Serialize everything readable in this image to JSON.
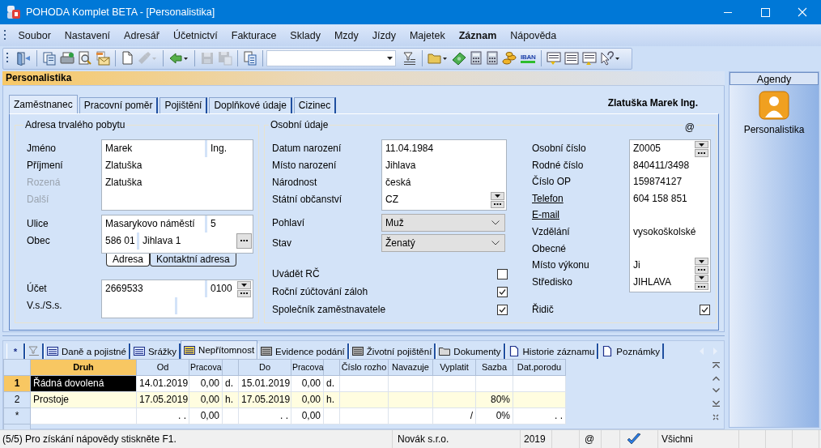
{
  "window": {
    "title": "POHODA Komplet BETA - [Personalistika]"
  },
  "menu": [
    {
      "label": "Soubor",
      "bold": false
    },
    {
      "label": "Nastavení",
      "bold": false
    },
    {
      "label": "Adresář",
      "bold": false
    },
    {
      "label": "Účetnictví",
      "bold": false
    },
    {
      "label": "Fakturace",
      "bold": false
    },
    {
      "label": "Sklady",
      "bold": false
    },
    {
      "label": "Mzdy",
      "bold": false
    },
    {
      "label": "Jízdy",
      "bold": false
    },
    {
      "label": "Majetek",
      "bold": false
    },
    {
      "label": "Záznam",
      "bold": true
    },
    {
      "label": "Nápověda",
      "bold": false
    }
  ],
  "toolbar": [
    {
      "buttons": [
        {
          "kind": "exit",
          "disabled": false
        }
      ]
    },
    {
      "buttons": [
        {
          "kind": "copy_data",
          "disabled": false
        },
        {
          "kind": "print",
          "disabled": false
        },
        {
          "kind": "preview",
          "disabled": false
        },
        {
          "kind": "mail",
          "disabled": false
        }
      ]
    },
    {
      "buttons": [
        {
          "kind": "new",
          "disabled": false
        },
        {
          "kind": "brush_menu",
          "disabled": true
        }
      ]
    },
    {
      "buttons": [
        {
          "kind": "back_menu",
          "disabled": false
        }
      ]
    },
    {
      "buttons": [
        {
          "kind": "save",
          "disabled": true
        },
        {
          "kind": "save_all",
          "disabled": true
        }
      ]
    },
    {
      "buttons": [
        {
          "kind": "copy",
          "disabled": false
        }
      ]
    },
    {
      "buttons": [
        {
          "kind": "combo",
          "disabled": false
        },
        {
          "kind": "filter",
          "disabled": false
        }
      ]
    },
    {
      "buttons": [
        {
          "kind": "folder_menu",
          "disabled": false
        },
        {
          "kind": "money",
          "disabled": false
        },
        {
          "kind": "calc",
          "disabled": false
        },
        {
          "kind": "calc2",
          "disabled": false
        },
        {
          "kind": "coins",
          "disabled": false
        },
        {
          "kind": "iban",
          "text": "IBAN",
          "disabled": false
        }
      ]
    },
    {
      "buttons": [
        {
          "kind": "list_down",
          "disabled": false
        },
        {
          "kind": "list",
          "disabled": false
        },
        {
          "kind": "list_up",
          "disabled": false
        },
        {
          "kind": "help_menu",
          "disabled": false
        }
      ]
    }
  ],
  "panel_title": "Personalistika",
  "tabs": [
    {
      "label": "Zaměstnanec",
      "selected": true
    },
    {
      "label": "Pracovní poměr",
      "selected": false
    },
    {
      "label": "Pojištění",
      "selected": false
    },
    {
      "label": "Doplňkové údaje",
      "selected": false
    },
    {
      "label": "Cizinec",
      "selected": false
    }
  ],
  "record_title": "Zlatuška Marek Ing.",
  "address": {
    "title": "Adresa trvalého pobytu",
    "name_fields": [
      {
        "label": "Jméno",
        "value": "Marek",
        "extra": "Ing.",
        "disabled": false
      },
      {
        "label": "Příjmení",
        "value": "Zlatuška",
        "disabled": false
      },
      {
        "label": "Rozená",
        "value": "Zlatuška",
        "disabled": true
      },
      {
        "label": "Další",
        "disabled": true
      }
    ],
    "address_fields": [
      {
        "label": "Ulice",
        "value": "Masarykovo náměstí",
        "extra": "5",
        "kind": "text"
      },
      {
        "label": "Obec",
        "prefix": "586 01",
        "value": "Jihlava 1",
        "kind": "lookup"
      }
    ],
    "address_tabs": [
      {
        "label": "Adresa",
        "selected": true
      },
      {
        "label": "Kontaktní adresa",
        "selected": false
      }
    ],
    "bank_fields": [
      {
        "label": "Účet",
        "value": "2669533",
        "extra": "0100",
        "kind": "combo_lookup"
      },
      {
        "label": "V.s./S.s.",
        "kind": "split"
      }
    ]
  },
  "personal": {
    "title": "Osobní údaje",
    "email_mark": "@",
    "fields": [
      {
        "label": "Datum narození",
        "value": "11.04.1984",
        "kind": "text"
      },
      {
        "label": "Místo narození",
        "value": "Jihlava",
        "kind": "text"
      },
      {
        "label": "Národnost",
        "value": "česká",
        "kind": "text"
      },
      {
        "label": "Státní občanství",
        "value": "CZ",
        "kind": "combo_lookup"
      }
    ],
    "selects": [
      {
        "label": "Pohlaví",
        "value": "Muž"
      },
      {
        "label": "Stav",
        "value": "Ženatý"
      }
    ],
    "checks": [
      {
        "label": "Uvádět RČ",
        "checked": false
      },
      {
        "label": "Roční zúčtování záloh",
        "checked": true
      },
      {
        "label": "Společník zaměstnavatele",
        "checked": true
      }
    ],
    "ids": [
      {
        "label": "Osobní číslo",
        "value": "Z0005",
        "kind": "combo_lookup",
        "link": false
      },
      {
        "label": "Rodné číslo",
        "value": "840411/3498",
        "kind": "text",
        "link": false
      },
      {
        "label": "Číslo OP",
        "value": "159874127",
        "kind": "text",
        "link": false
      },
      {
        "label": "Telefon",
        "value": "604 158 851",
        "kind": "text",
        "link": true
      },
      {
        "label": "E-mail",
        "kind": "text",
        "link": true
      },
      {
        "label": "Vzdělání",
        "value": "vysokoškolské",
        "kind": "text",
        "link": false
      },
      {
        "label": "Obecné",
        "kind": "text",
        "link": false
      },
      {
        "label": "Místo výkonu",
        "value": "Ji",
        "kind": "combo_lookup",
        "link": false
      },
      {
        "label": "Středisko",
        "value": "JIHLAVA",
        "kind": "combo_lookup",
        "link": false
      }
    ],
    "id_checks": [
      {
        "label": "Řidič",
        "checked": true
      }
    ]
  },
  "detail_tabs": [
    {
      "kind": "new",
      "label": "*",
      "selected": false
    },
    {
      "kind": "filter",
      "selected": false
    },
    {
      "kind": "table_data",
      "label": "Daně a pojistné",
      "selected": false
    },
    {
      "kind": "table_data",
      "label": "Srážky",
      "selected": false
    },
    {
      "kind": "table_data",
      "label": "Nepřítomnost",
      "selected": true
    },
    {
      "kind": "table_empty",
      "label": "Evidence podání",
      "selected": false
    },
    {
      "kind": "table_empty",
      "label": "Životní pojištění",
      "selected": false
    },
    {
      "kind": "folder",
      "label": "Dokumenty",
      "selected": false
    },
    {
      "kind": "page",
      "label": "Historie záznamu",
      "selected": false
    },
    {
      "kind": "page",
      "label": "Poznámky",
      "selected": false
    }
  ],
  "grid": {
    "columns": [
      {
        "label": "Druh",
        "sorted": true
      },
      {
        "label": "Od",
        "sorted": false
      },
      {
        "label": "Pracova",
        "sorted": false
      },
      {
        "sorted": false
      },
      {
        "label": "Do",
        "sorted": false
      },
      {
        "label": "Pracova",
        "sorted": false
      },
      {
        "sorted": false
      },
      {
        "label": "Číslo rozho",
        "sorted": false
      },
      {
        "label": "Navazuje",
        "sorted": false
      },
      {
        "label": "Vyplatit",
        "sorted": false
      },
      {
        "label": "Sazba",
        "sorted": false
      },
      {
        "label": "Dat.porodu",
        "sorted": false
      }
    ],
    "rows": [
      {
        "header": "1",
        "selected": true,
        "marked": false,
        "cells": [
          "Řádná dovolená",
          "14.01.2019",
          "0,00",
          "d.",
          "15.01.2019",
          "0,00",
          "d.",
          null,
          null,
          null,
          null,
          null
        ]
      },
      {
        "header": "2",
        "selected": false,
        "marked": true,
        "cells": [
          "Prostoje",
          "17.05.2019",
          "0,00",
          "h.",
          "17.05.2019",
          "0,00",
          "h.",
          null,
          null,
          null,
          "80%",
          null
        ]
      },
      {
        "header": "*",
        "selected": false,
        "marked": false,
        "cells": [
          null,
          ". .",
          "0,00",
          null,
          ". .",
          "0,00",
          null,
          null,
          null,
          "/",
          "0%",
          ". ."
        ]
      }
    ]
  },
  "agendas": {
    "title": "Agendy",
    "items": [
      {
        "label": "Personalistika"
      }
    ]
  },
  "status_bar": {
    "message": "(5/5) Pro získání nápovědy stiskněte F1.",
    "company": "Novák s.r.o.",
    "year": "2019",
    "email_mark": "@",
    "user": "Všichni"
  }
}
